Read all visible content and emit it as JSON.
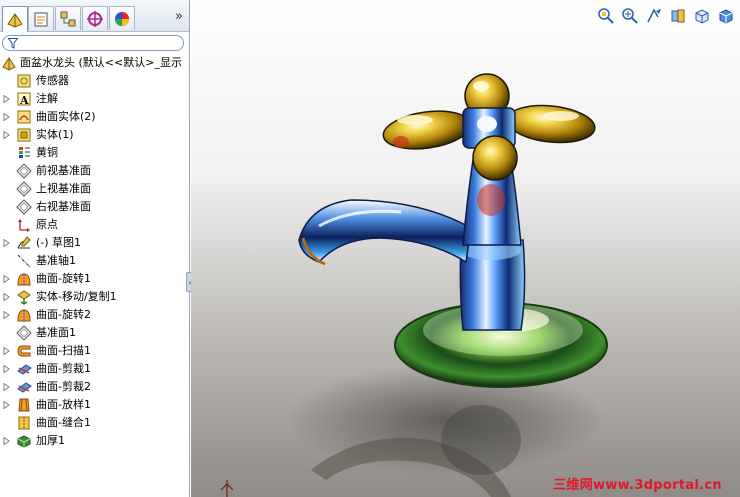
{
  "feature_tree": {
    "root_label": "面盆水龙头 (默认<<默认>_显示",
    "items": [
      {
        "label": "传感器",
        "icon": "sensors-icon",
        "expandable": false
      },
      {
        "label": "注解",
        "icon": "annotations-icon",
        "expandable": true
      },
      {
        "label": "曲面实体(2)",
        "icon": "surface-bodies-icon",
        "expandable": true
      },
      {
        "label": "实体(1)",
        "icon": "solid-bodies-icon",
        "expandable": true
      },
      {
        "label": "黄铜",
        "icon": "material-icon",
        "expandable": false
      },
      {
        "label": "前视基准面",
        "icon": "plane-icon",
        "expandable": false
      },
      {
        "label": "上视基准面",
        "icon": "plane-icon",
        "expandable": false
      },
      {
        "label": "右视基准面",
        "icon": "plane-icon",
        "expandable": false
      },
      {
        "label": "原点",
        "icon": "origin-icon",
        "expandable": false
      },
      {
        "label": "(-) 草图1",
        "icon": "sketch-icon",
        "expandable": true
      },
      {
        "label": "基准轴1",
        "icon": "axis-icon",
        "expandable": false
      },
      {
        "label": "曲面-旋转1",
        "icon": "surface-revolve-icon",
        "expandable": true
      },
      {
        "label": "实体-移动/复制1",
        "icon": "move-copy-icon",
        "expandable": true
      },
      {
        "label": "曲面-旋转2",
        "icon": "surface-revolve-icon",
        "expandable": true
      },
      {
        "label": "基准面1",
        "icon": "plane-icon",
        "expandable": false
      },
      {
        "label": "曲面-扫描1",
        "icon": "surface-sweep-icon",
        "expandable": true
      },
      {
        "label": "曲面-剪裁1",
        "icon": "surface-trim-icon",
        "expandable": true
      },
      {
        "label": "曲面-剪裁2",
        "icon": "surface-trim-icon",
        "expandable": true
      },
      {
        "label": "曲面-放样1",
        "icon": "surface-loft-icon",
        "expandable": true
      },
      {
        "label": "曲面-缝合1",
        "icon": "surface-knit-icon",
        "expandable": false
      },
      {
        "label": "加厚1",
        "icon": "thicken-icon",
        "expandable": true
      }
    ]
  },
  "panel_tabs": [
    "feature-manager-tab-icon",
    "property-manager-tab-icon",
    "configuration-manager-tab-icon",
    "dimxpert-tab-icon",
    "display-manager-tab-icon"
  ],
  "tabs_more": "»",
  "view_toolbar": [
    "zoom-to-fit-icon",
    "zoom-to-area-icon",
    "previous-view-icon",
    "section-view-icon",
    "view-orientation-icon",
    "display-style-icon"
  ],
  "watermark": "三维网www.3dportal.cn",
  "colors": {
    "watermark": "#e0182a",
    "panel_border": "#9aa6b8",
    "accent": "#316ac5"
  }
}
